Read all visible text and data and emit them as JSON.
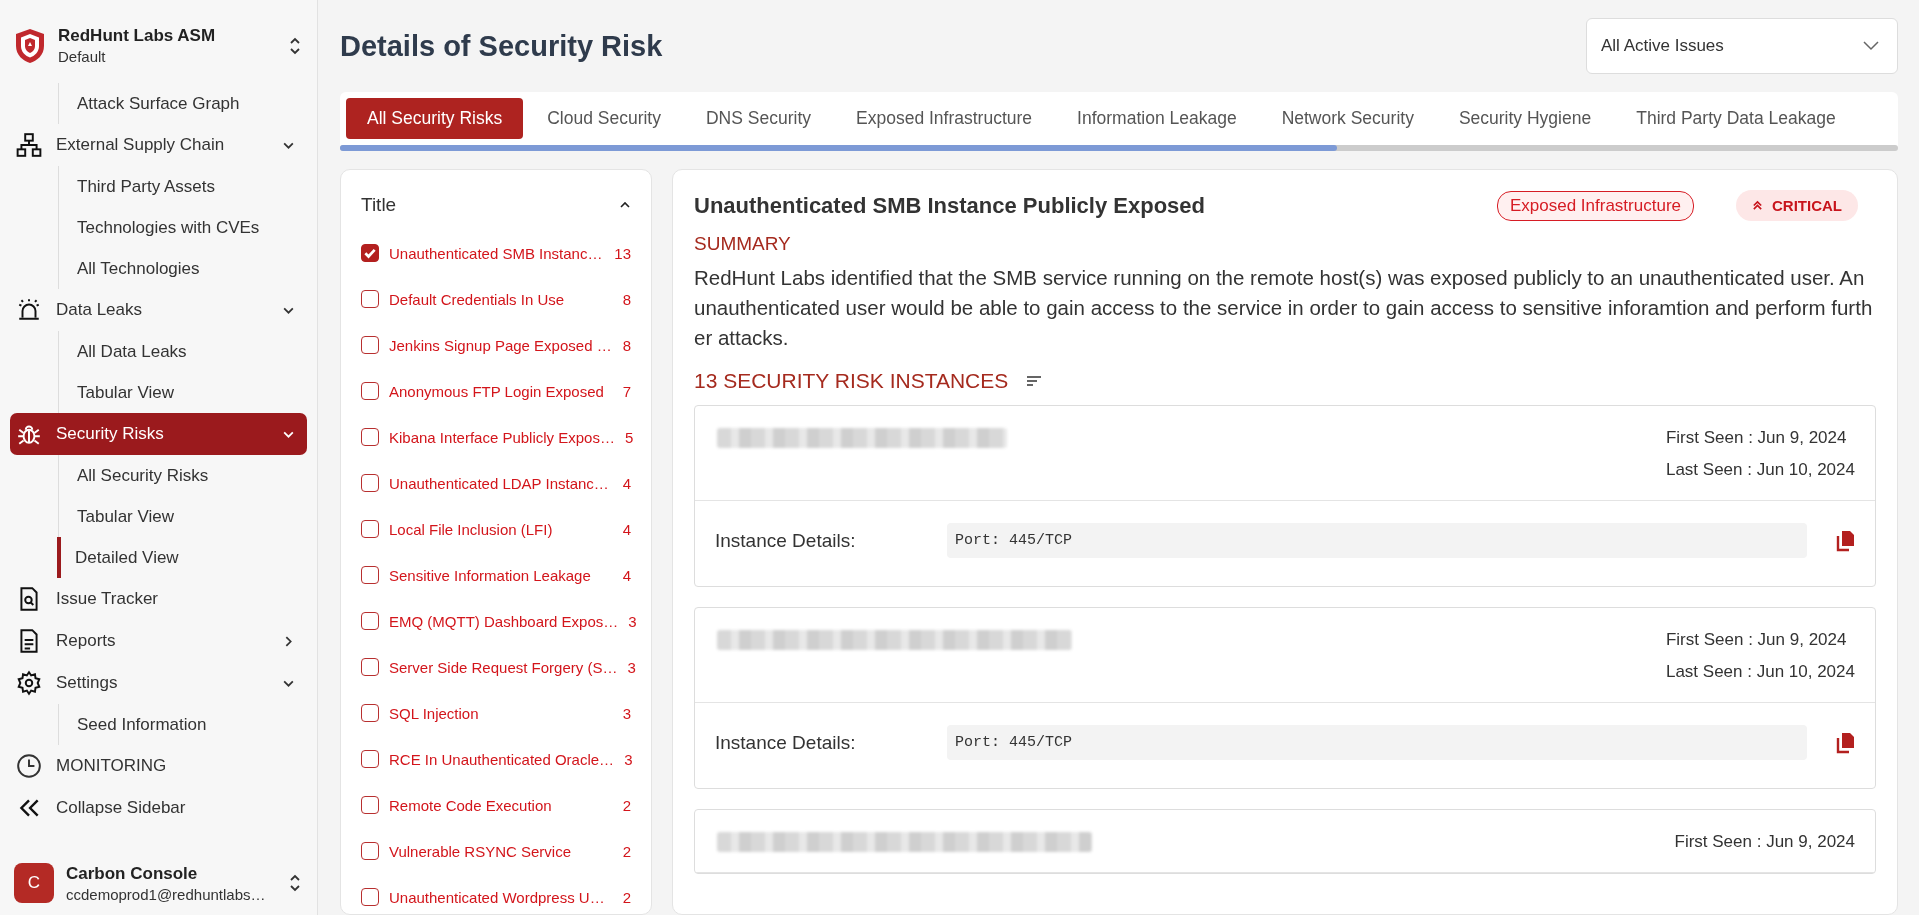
{
  "app": {
    "name": "RedHunt Labs ASM",
    "workspace": "Default"
  },
  "nav": [
    {
      "kind": "section",
      "children": [
        {
          "label": "Attack Surface Graph",
          "selected": false
        }
      ]
    },
    {
      "kind": "group",
      "label": "External Supply Chain",
      "expanded": true,
      "selected": false,
      "children": [
        {
          "label": "Third Party Assets",
          "selected": false
        },
        {
          "label": "Technologies with CVEs",
          "selected": false
        },
        {
          "label": "All Technologies",
          "selected": false
        }
      ]
    },
    {
      "kind": "group",
      "label": "Data Leaks",
      "expanded": true,
      "selected": false,
      "children": [
        {
          "label": "All Data Leaks",
          "selected": false
        },
        {
          "label": "Tabular View",
          "selected": false
        }
      ]
    },
    {
      "kind": "group",
      "label": "Security Risks",
      "expanded": true,
      "selected": true,
      "children": [
        {
          "label": "All Security Risks",
          "selected": false
        },
        {
          "label": "Tabular View",
          "selected": false
        },
        {
          "label": "Detailed View",
          "selected": true
        }
      ]
    },
    {
      "kind": "link",
      "label": "Issue Tracker",
      "selected": false
    },
    {
      "kind": "group",
      "label": "Reports",
      "expanded": false,
      "selected": false
    },
    {
      "kind": "group",
      "label": "Settings",
      "expanded": true,
      "selected": false,
      "children": [
        {
          "label": "Seed Information",
          "selected": false
        }
      ]
    },
    {
      "kind": "link",
      "label": "MONITORING",
      "selected": false
    }
  ],
  "collapse": {
    "label": "Collapse Sidebar"
  },
  "user": {
    "initial": "C",
    "name": "Carbon Console",
    "email": "ccdemoprod1@redhuntlabs…"
  },
  "page": {
    "title": "Details of Security Risk",
    "filter": "All Active Issues"
  },
  "tabs": [
    {
      "label": "All Security Risks",
      "selected": true
    },
    {
      "label": "Cloud Security",
      "selected": false
    },
    {
      "label": "DNS Security",
      "selected": false
    },
    {
      "label": "Exposed Infrastructure",
      "selected": false
    },
    {
      "label": "Information Leakage",
      "selected": false
    },
    {
      "label": "Network Security",
      "selected": false
    },
    {
      "label": "Security Hygiene",
      "selected": false
    },
    {
      "label": "Third Party Data Leakage",
      "selected": false
    }
  ],
  "filter_list": {
    "heading": "Title",
    "expanded": true,
    "items": [
      {
        "title": "Unauthenticated SMB Instanc…",
        "count": "13",
        "checked": true
      },
      {
        "title": "Default Credentials In Use",
        "count": "8",
        "checked": false
      },
      {
        "title": "Jenkins Signup Page Exposed …",
        "count": "8",
        "checked": false
      },
      {
        "title": "Anonymous FTP Login Exposed",
        "count": "7",
        "checked": false
      },
      {
        "title": "Kibana Interface Publicly Expos…",
        "count": "5",
        "checked": false
      },
      {
        "title": "Unauthenticated LDAP Instanc…",
        "count": "4",
        "checked": false
      },
      {
        "title": "Local File Inclusion (LFI)",
        "count": "4",
        "checked": false
      },
      {
        "title": "Sensitive Information Leakage",
        "count": "4",
        "checked": false
      },
      {
        "title": "EMQ (MQTT) Dashboard Expos…",
        "count": "3",
        "checked": false
      },
      {
        "title": "Server Side Request Forgery (S…",
        "count": "3",
        "checked": false
      },
      {
        "title": "SQL Injection",
        "count": "3",
        "checked": false
      },
      {
        "title": "RCE In Unauthenticated Oracle…",
        "count": "3",
        "checked": false
      },
      {
        "title": "Remote Code Execution",
        "count": "2",
        "checked": false
      },
      {
        "title": "Vulnerable RSYNC Service",
        "count": "2",
        "checked": false
      },
      {
        "title": "Unauthenticated Wordpress U…",
        "count": "2",
        "checked": false
      }
    ]
  },
  "detail": {
    "title": "Unauthenticated SMB Instance Publicly Exposed",
    "category": "Exposed Infrastructure",
    "severity": "CRITICAL",
    "summary_heading": "SUMMARY",
    "summary": "RedHunt Labs identified that the SMB service running on the remote host(s) was exposed publicly to an unauthenticated user. An unauthenticated user would be able to gain access to the service in order to gain access to sensitive inforamtion and perform further attacks.",
    "instances_heading": "13 SECURITY RISK INSTANCES",
    "instances": [
      {
        "first_seen": "First Seen : Jun 9, 2024",
        "last_seen": "Last Seen : Jun 10, 2024",
        "details_label": "Instance Details:",
        "details": "Port: 445/TCP"
      },
      {
        "first_seen": "First Seen : Jun 9, 2024",
        "last_seen": "Last Seen : Jun 10, 2024",
        "details_label": "Instance Details:",
        "details": "Port: 445/TCP"
      },
      {
        "first_seen": "First Seen : Jun 9, 2024"
      }
    ]
  }
}
